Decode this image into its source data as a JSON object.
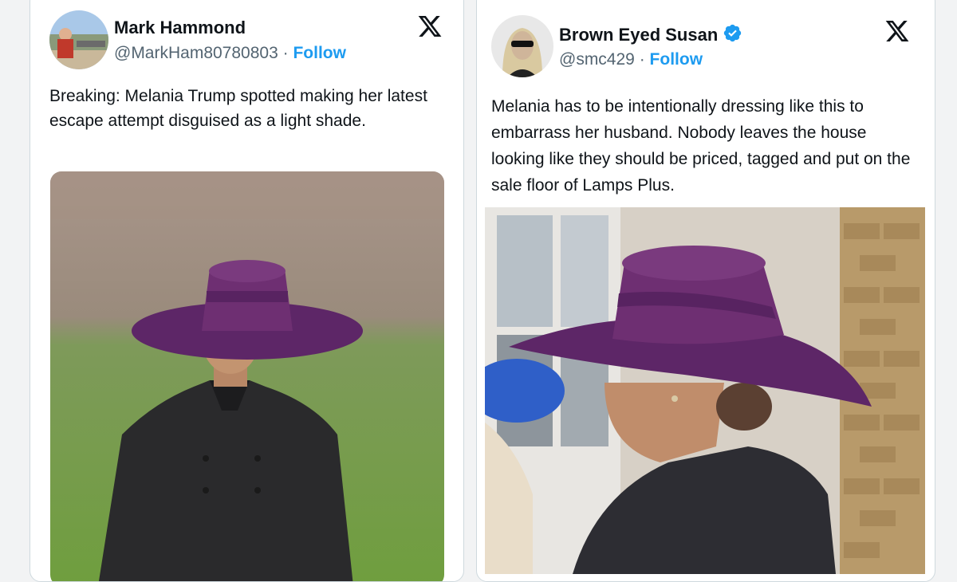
{
  "tweets": [
    {
      "name": "Mark Hammond",
      "handle": "@MarkHam80780803",
      "separator": "·",
      "follow_label": "Follow",
      "verified": false,
      "text": "Breaking: Melania Trump spotted making her latest escape attempt disguised as a light shade.",
      "media_desc": "woman-in-purple-wide-brim-hat-on-lawn"
    },
    {
      "name": "Brown Eyed Susan",
      "handle": "@smc429",
      "separator": "·",
      "follow_label": "Follow",
      "verified": true,
      "text": "Melania has to be intentionally dressing like this to embarrass her husband. Nobody leaves the house looking like they should be priced, tagged and put on the sale floor of Lamps Plus.",
      "media_desc": "woman-in-purple-wide-brim-hat-profile"
    }
  ],
  "colors": {
    "link_blue": "#1d9bf0",
    "text": "#0f1419",
    "secondary": "#536471",
    "hat_purple": "#6e2f72"
  },
  "icons": [
    "x-logo-icon",
    "verified-badge-icon"
  ]
}
